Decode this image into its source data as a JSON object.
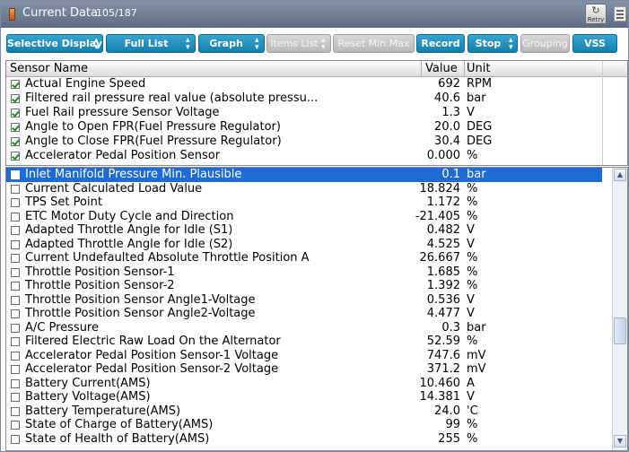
{
  "window": {
    "title": "Current Data",
    "count": "105/187",
    "retry_label": "Retry"
  },
  "toolbar": {
    "selective_display": "Selective Display",
    "full_list": "Full List",
    "graph": "Graph",
    "items_list": "Items List",
    "reset_min_max": "Reset Min.Max",
    "record": "Record",
    "stop": "Stop",
    "grouping": "Grouping",
    "vss": "VSS"
  },
  "table": {
    "headers": {
      "name": "Sensor Name",
      "value": "Value",
      "unit": "Unit"
    }
  },
  "selected_rows": [
    {
      "name": "Actual Engine Speed",
      "value": "692",
      "unit": "RPM",
      "checked": true
    },
    {
      "name": "Filtered rail pressure real value (absolute pressu...",
      "value": "40.6",
      "unit": "bar",
      "checked": true
    },
    {
      "name": "Fuel Rail pressure Sensor Voltage",
      "value": "1.3",
      "unit": "V",
      "checked": true
    },
    {
      "name": "Angle to Open FPR(Fuel Pressure Regulator)",
      "value": "20.0",
      "unit": "DEG",
      "checked": true
    },
    {
      "name": "Angle to Close FPR(Fuel Pressure Regulator)",
      "value": "30.4",
      "unit": "DEG",
      "checked": true
    },
    {
      "name": "Accelerator Pedal Position Sensor",
      "value": "0.000",
      "unit": "%",
      "checked": true
    }
  ],
  "all_rows": [
    {
      "name": "Inlet Manifold Pressure Min. Plausible",
      "value": "0.1",
      "unit": "bar",
      "checked": false,
      "highlighted": true
    },
    {
      "name": "Current Calculated Load Value",
      "value": "18.824",
      "unit": "%",
      "checked": false
    },
    {
      "name": "TPS Set Point",
      "value": "1.172",
      "unit": "%",
      "checked": false
    },
    {
      "name": "ETC Motor Duty Cycle and Direction",
      "value": "-21.405",
      "unit": "%",
      "checked": false
    },
    {
      "name": "Adapted Throttle Angle for Idle (S1)",
      "value": "0.482",
      "unit": "V",
      "checked": false
    },
    {
      "name": "Adapted Throttle Angle for Idle (S2)",
      "value": "4.525",
      "unit": "V",
      "checked": false
    },
    {
      "name": "Current Undefaulted Absolute Throttle Position A",
      "value": "26.667",
      "unit": "%",
      "checked": false
    },
    {
      "name": "Throttle Position Sensor-1",
      "value": "1.685",
      "unit": "%",
      "checked": false
    },
    {
      "name": "Throttle Position Sensor-2",
      "value": "1.392",
      "unit": "%",
      "checked": false
    },
    {
      "name": "Throttle Position Sensor Angle1-Voltage",
      "value": "0.536",
      "unit": "V",
      "checked": false
    },
    {
      "name": "Throttle Position Sensor Angle2-Voltage",
      "value": "4.477",
      "unit": "V",
      "checked": false
    },
    {
      "name": "A/C Pressure",
      "value": "0.3",
      "unit": "bar",
      "checked": false
    },
    {
      "name": "Filtered Electric Raw Load On the Alternator",
      "value": "52.59",
      "unit": "%",
      "checked": false
    },
    {
      "name": "Accelerator Pedal Position Sensor-1 Voltage",
      "value": "747.6",
      "unit": "mV",
      "checked": false
    },
    {
      "name": "Accelerator Pedal Position Sensor-2 Voltage",
      "value": "371.2",
      "unit": "mV",
      "checked": false
    },
    {
      "name": "Battery Current(AMS)",
      "value": "10.460",
      "unit": "A",
      "checked": false
    },
    {
      "name": "Battery Voltage(AMS)",
      "value": "14.381",
      "unit": "V",
      "checked": false
    },
    {
      "name": "Battery Temperature(AMS)",
      "value": "24.0",
      "unit": "'C",
      "checked": false
    },
    {
      "name": "State of Charge of Battery(AMS)",
      "value": "99",
      "unit": "%",
      "checked": false
    },
    {
      "name": "State of Health of Battery(AMS)",
      "value": "255",
      "unit": "%",
      "checked": false
    }
  ],
  "theme": {
    "title_bar": "#6b7a92",
    "button_blue": "#1f8fc0",
    "button_disabled": "#c4c4c4",
    "highlight": "#1f6bd6"
  },
  "icons": {
    "title": "orange-bar-icon",
    "retry": "retry-icon",
    "menu": "menu-icon",
    "dropdown": "updown-arrow-icon",
    "checkbox": "checkbox-icon"
  }
}
